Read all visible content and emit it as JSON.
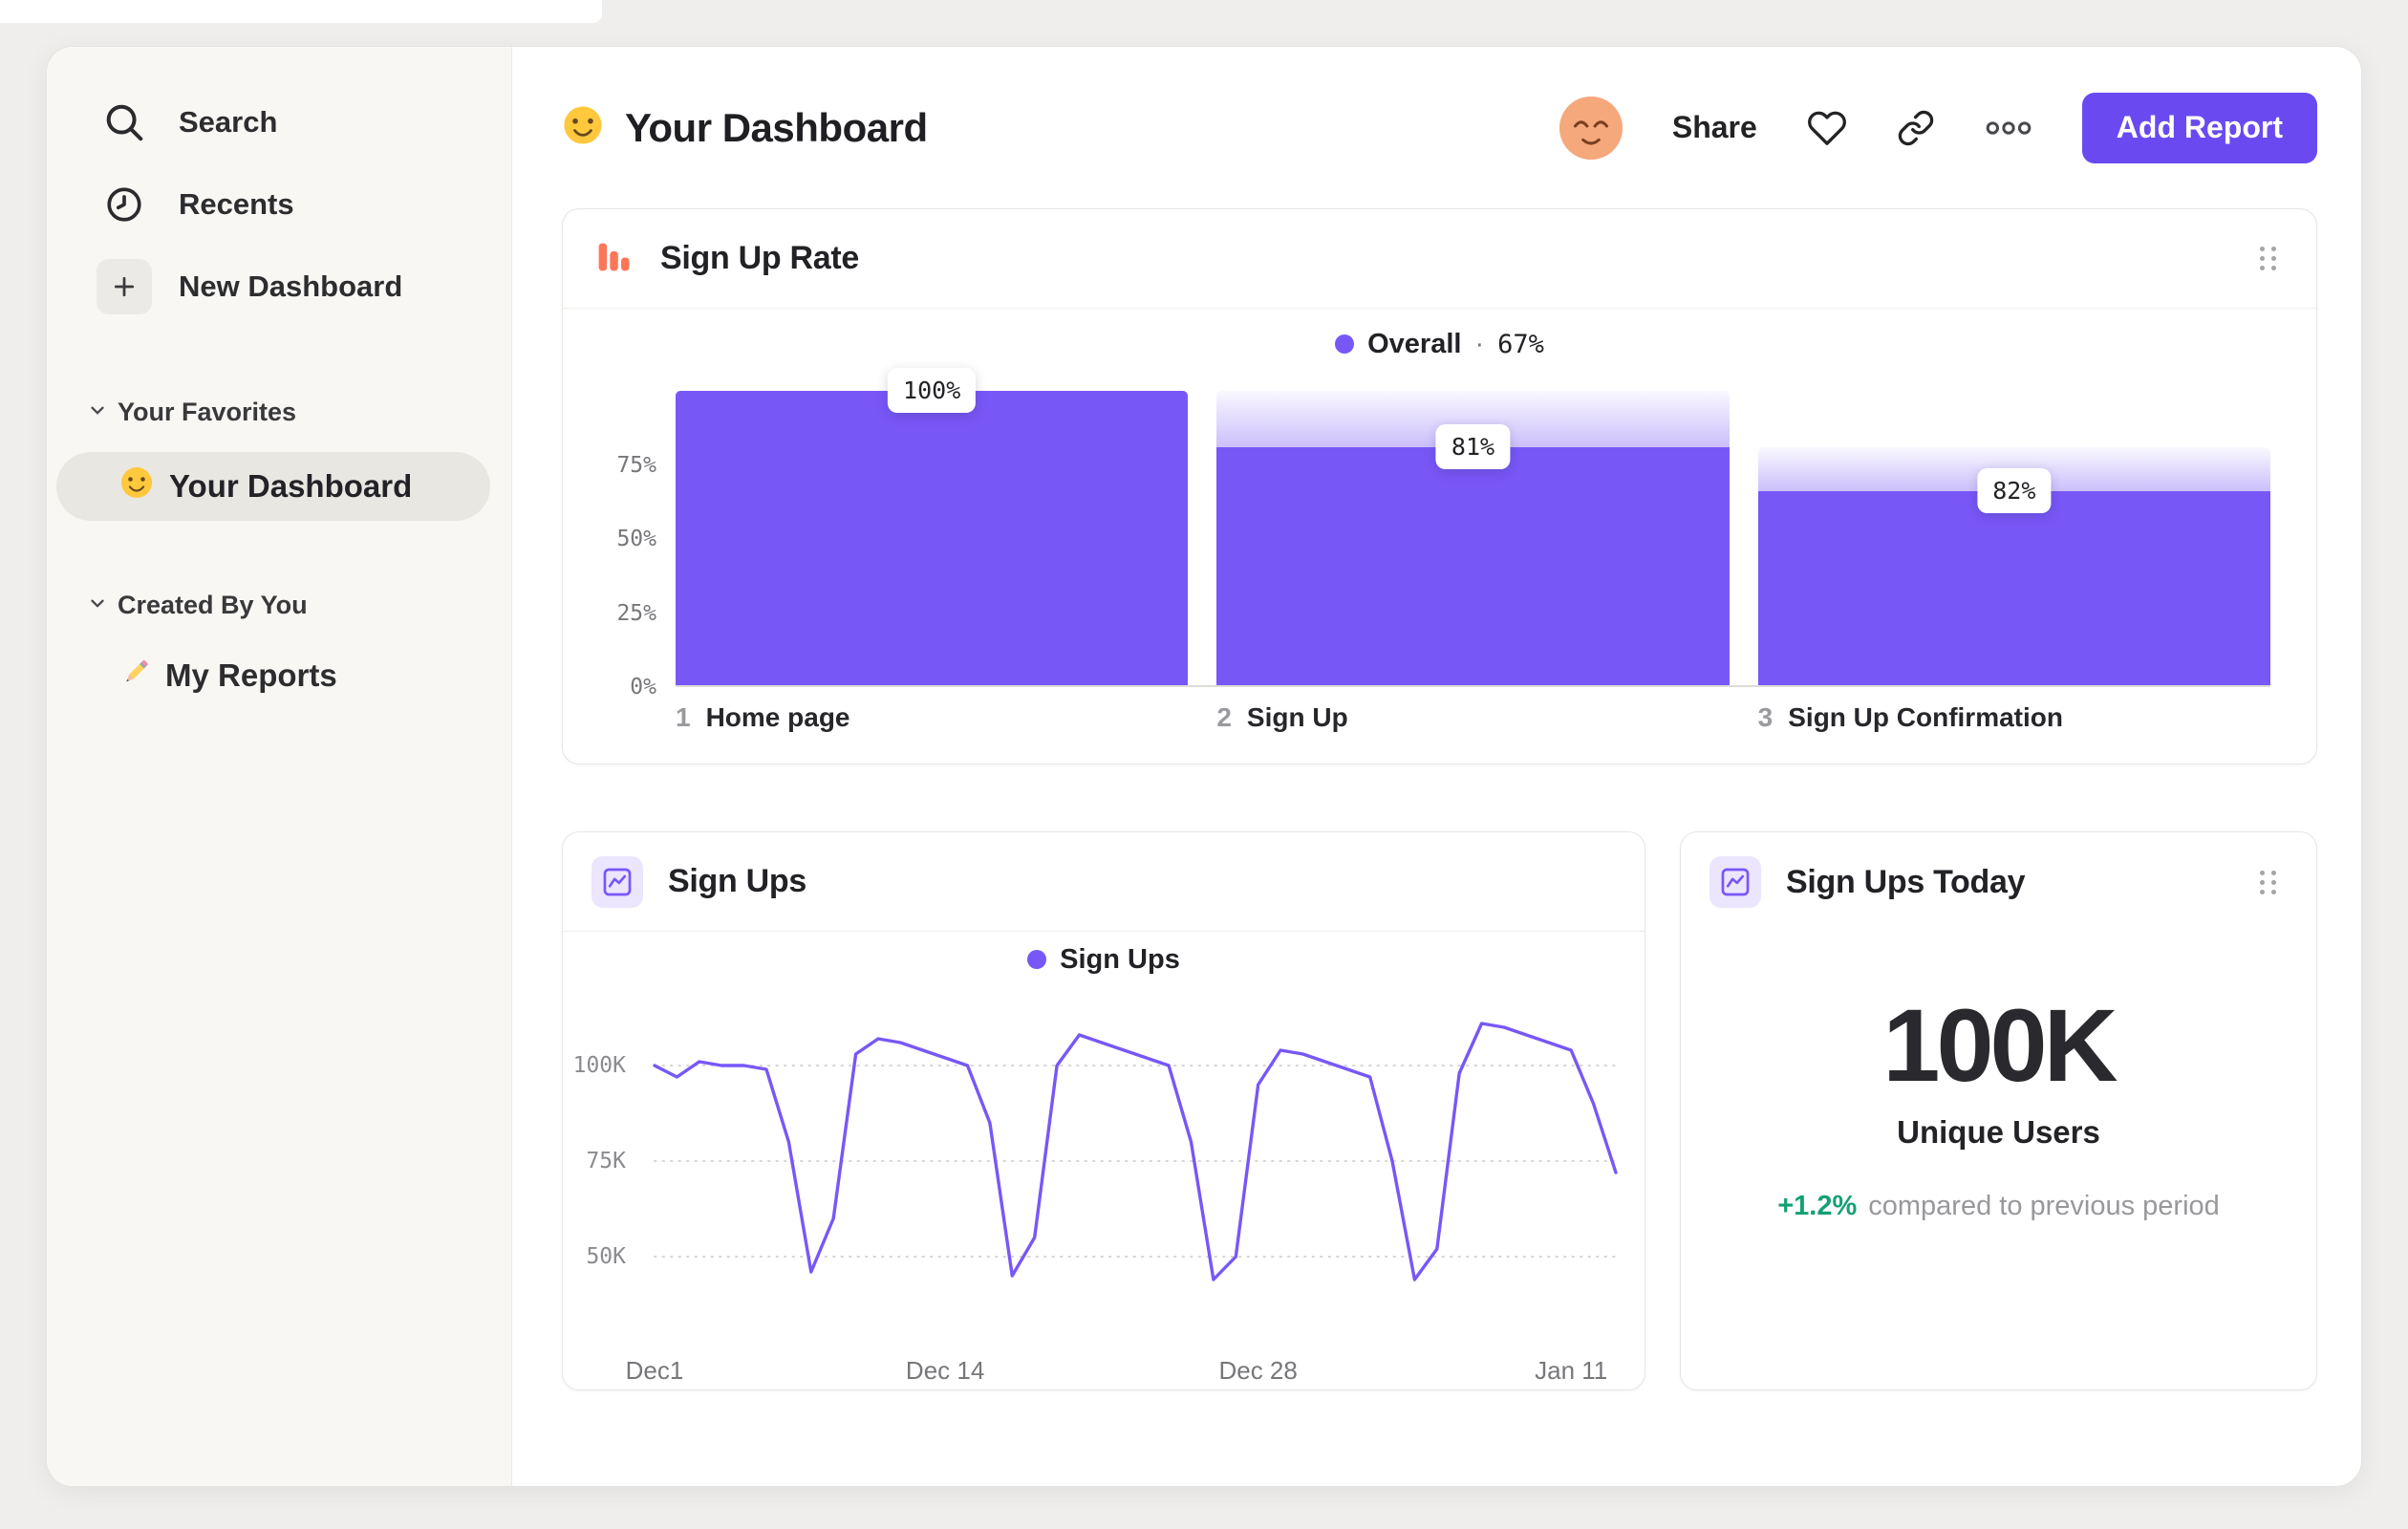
{
  "colors": {
    "accent": "#7857f7",
    "button": "#6a4af0",
    "orange": "#ff7557",
    "green": "#14a076",
    "sidebar_bg": "#f8f7f4"
  },
  "icons": {
    "search": "magnifier",
    "recents": "clock",
    "new_dashboard": "plus",
    "section_toggle": "chevron-down",
    "favorites_item": "slightly-smiling-face-emoji",
    "reports_item": "pencil-emoji",
    "page_title": "slightly-smiling-face-emoji",
    "avatar": "relieved-face",
    "favorite": "heart-outline",
    "copy_link": "link",
    "more": "ellipsis",
    "signup_rate_card": "funnel-bar-chart",
    "signups_card": "line-chart",
    "drag": "drag-handle-dots"
  },
  "sidebar": {
    "search": "Search",
    "recents": "Recents",
    "new_dashboard": "New Dashboard",
    "favorites_section": "Your Favorites",
    "favorites_item": "Your Dashboard",
    "created_section": "Created By You",
    "created_item": "My Reports"
  },
  "header": {
    "title": "Your Dashboard",
    "share": "Share",
    "add_report": "Add Report"
  },
  "chart_data": [
    {
      "type": "bar",
      "variant": "funnel",
      "title": "Sign Up Rate",
      "legend": {
        "name": "Overall",
        "separator": "·",
        "value": "67%"
      },
      "ylabel_ticks": [
        "75%",
        "50%",
        "25%",
        "0%"
      ],
      "ylim": [
        0,
        100
      ],
      "steps": [
        {
          "num": "1",
          "label": "Home page",
          "value_label": "100%",
          "overall_pct": 100,
          "from_pct": 100
        },
        {
          "num": "2",
          "label": "Sign Up",
          "value_label": "81%",
          "overall_pct": 81,
          "from_pct": 100
        },
        {
          "num": "3",
          "label": "Sign Up Confirmation",
          "value_label": "82%",
          "overall_pct": 66,
          "from_pct": 81
        }
      ]
    },
    {
      "type": "line",
      "title": "Sign Ups",
      "legend": {
        "name": "Sign Ups"
      },
      "unit": "K",
      "ylim": [
        28,
        118
      ],
      "yticks": [
        100,
        75,
        50
      ],
      "ytick_labels": [
        "100K",
        "75K",
        "50K"
      ],
      "x_ticks": [
        {
          "label": "Dec1",
          "day": 0
        },
        {
          "label": "Dec 14",
          "day": 13
        },
        {
          "label": "Dec 28",
          "day": 27
        },
        {
          "label": "Jan 11",
          "day": 41
        }
      ],
      "series": [
        {
          "name": "Sign Ups",
          "values": [
            100,
            97,
            101,
            100,
            100,
            99,
            80,
            46,
            60,
            103,
            107,
            106,
            104,
            102,
            100,
            85,
            45,
            55,
            100,
            108,
            106,
            104,
            102,
            100,
            80,
            44,
            50,
            95,
            104,
            103,
            101,
            99,
            97,
            75,
            44,
            52,
            98,
            111,
            110,
            108,
            106,
            104,
            90,
            72
          ]
        }
      ]
    },
    {
      "type": "big_number",
      "title": "Sign Ups Today",
      "value": "100K",
      "label": "Unique Users",
      "delta": "+1.2%",
      "delta_note": "compared to previous period"
    }
  ]
}
